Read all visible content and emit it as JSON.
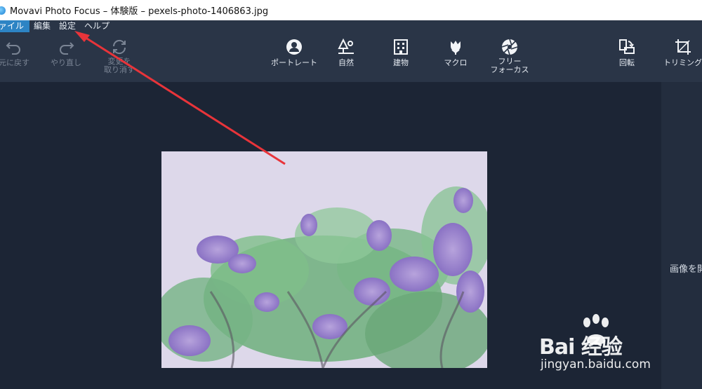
{
  "window": {
    "title": "Movavi Photo Focus – 体験版 – pexels-photo-1406863.jpg"
  },
  "menu": {
    "items": [
      {
        "label": "ァイル",
        "active": true
      },
      {
        "label": "編集"
      },
      {
        "label": "設定"
      },
      {
        "label": "ヘルプ"
      }
    ]
  },
  "toolbar": {
    "undo_label": "元に戻す",
    "redo_label": "やり直し",
    "reset_label_line1": "変更を",
    "reset_label_line2": "取り消す",
    "portrait_label": "ポートレート",
    "nature_label": "自然",
    "building_label": "建物",
    "macro_label": "マクロ",
    "freefocus_label_line1": "フリー",
    "freefocus_label_line2": "フォーカス",
    "rotate_label": "回転",
    "crop_label": "トリミング"
  },
  "right_panel": {
    "text": "画像を開"
  },
  "watermark": {
    "brand": "Bai  经验",
    "url": "jingyan.baidu.com"
  },
  "colors": {
    "menu_active": "#2d84c4",
    "toolbar_bg": "#2a3547",
    "canvas_bg": "#1c2535",
    "arrow": "#e8343a"
  }
}
